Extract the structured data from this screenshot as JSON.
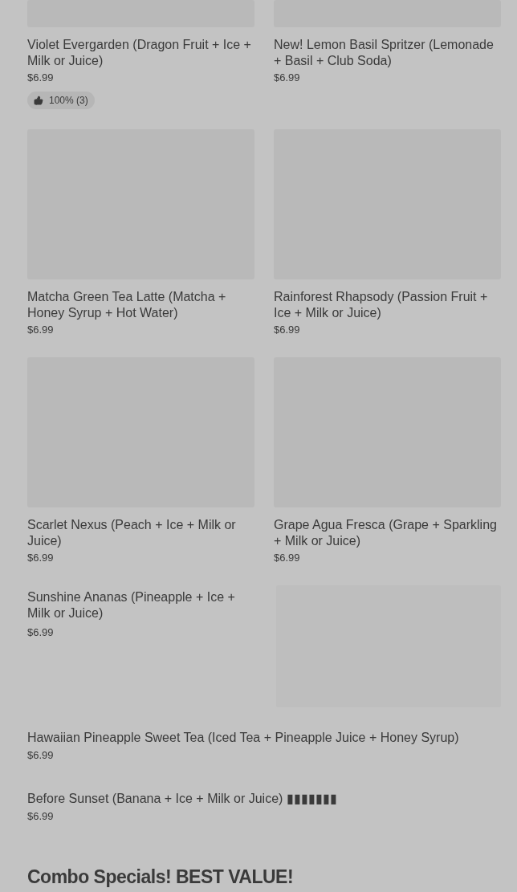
{
  "rows": [
    {
      "kind": "grid",
      "cards": [
        {
          "name": "Violet Evergarden (Dragon Fruit + Ice + Milk or Juice)",
          "price": "$6.99",
          "rating": "100% (3)"
        },
        {
          "name": "New! Lemon Basil Spritzer (Lemonade + Basil + Club Soda)",
          "price": "$6.99"
        }
      ]
    },
    {
      "kind": "grid",
      "cards": [
        {
          "name": "Matcha Green Tea Latte (Matcha + Honey Syrup + Hot Water)",
          "price": "$6.99"
        },
        {
          "name": "Rainforest Rhapsody (Passion Fruit + Ice + Milk or Juice)",
          "price": "$6.99"
        }
      ]
    },
    {
      "kind": "grid",
      "cards": [
        {
          "name": "Scarlet Nexus (Peach + Ice + Milk or Juice)",
          "price": "$6.99"
        },
        {
          "name": "Grape Agua Fresca (Grape + Sparkling + Milk or Juice)",
          "price": "$6.99"
        }
      ]
    },
    {
      "kind": "split",
      "cards": [
        {
          "name": "Sunshine Ananas (Pineapple + Ice + Milk or Juice)",
          "price": "$6.99"
        }
      ]
    },
    {
      "kind": "list",
      "cards": [
        {
          "name": "Hawaiian Pineapple Sweet Tea (Iced Tea + Pineapple Juice + Honey Syrup)",
          "price": "$6.99"
        }
      ]
    },
    {
      "kind": "list",
      "cards": [
        {
          "name": "Before Sunset (Banana + Ice + Milk or Juice) ▮▮▮▮▮▮▮",
          "price": "$6.99"
        }
      ]
    }
  ],
  "section_heading": "Combo Specials! BEST VALUE!"
}
